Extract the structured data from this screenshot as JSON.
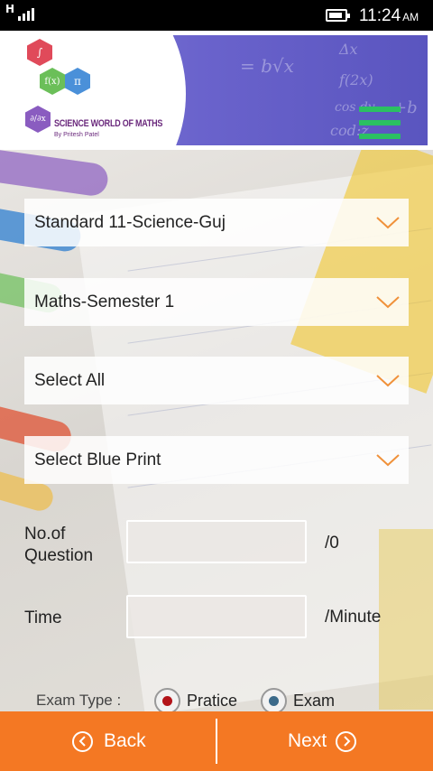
{
  "status_bar": {
    "network": "H",
    "time": "11:24",
    "ampm": "AM"
  },
  "header": {
    "logo_title": "SCIENCE WORLD OF MATHS",
    "logo_subtitle": "By Pritesh Patel",
    "hex_symbols": [
      "∫",
      "f(x)",
      "π",
      "∂/∂x"
    ]
  },
  "form": {
    "dropdowns": [
      {
        "label": "Standard 11-Science-Guj"
      },
      {
        "label": "Maths-Semester 1"
      },
      {
        "label": "Select All"
      },
      {
        "label": "Select Blue Print"
      }
    ],
    "question_label": "No.of Question",
    "question_value": "",
    "question_suffix": "/0",
    "time_label": "Time",
    "time_value": "",
    "time_suffix": "/Minute",
    "exam_type_label": "Exam Type :",
    "radio_options": [
      {
        "label": "Pratice",
        "selected": true,
        "dot_color": "#b3141a"
      },
      {
        "label": "Exam",
        "selected": false,
        "dot_color": "#3b6a8a"
      }
    ]
  },
  "footer": {
    "back_label": "Back",
    "next_label": "Next"
  },
  "colors": {
    "accent": "#f47823",
    "menu_green": "#2bc062",
    "arrow": "#f0913a"
  }
}
